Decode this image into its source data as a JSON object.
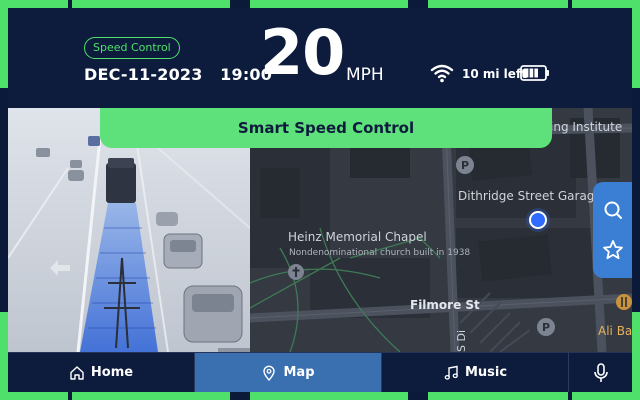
{
  "header": {
    "mode_pill": "Speed Control",
    "date": "DEC-11-2023",
    "time": "19:00",
    "speed_value": "20",
    "speed_unit": "MPH",
    "range_text": "10 mi left",
    "battery_level": 0.75
  },
  "banner": {
    "label": "Smart Speed Control"
  },
  "map": {
    "labels": {
      "institute": "ing Institute",
      "garage": "Dithridge Street Garag",
      "chapel_name": "Heinz Memorial Chapel",
      "chapel_desc": "Nondenominational church built in 1938",
      "street": "Filmore St",
      "street_vertical": "S Di",
      "restaurant": "Ali Bab"
    }
  },
  "side_actions": [
    "search-icon",
    "star-icon"
  ],
  "nav": {
    "items": [
      {
        "label": "Home",
        "icon": "home-icon",
        "active": false
      },
      {
        "label": "Map",
        "icon": "map-pin-icon",
        "active": true
      },
      {
        "label": "Music",
        "icon": "music-note-icon",
        "active": false
      }
    ],
    "voice_icon": "microphone-icon"
  },
  "colors": {
    "accent_green": "#4ee06a",
    "background_navy": "#0d1b3d",
    "active_blue": "#3a6fb0",
    "location_blue": "#2f6bff"
  }
}
